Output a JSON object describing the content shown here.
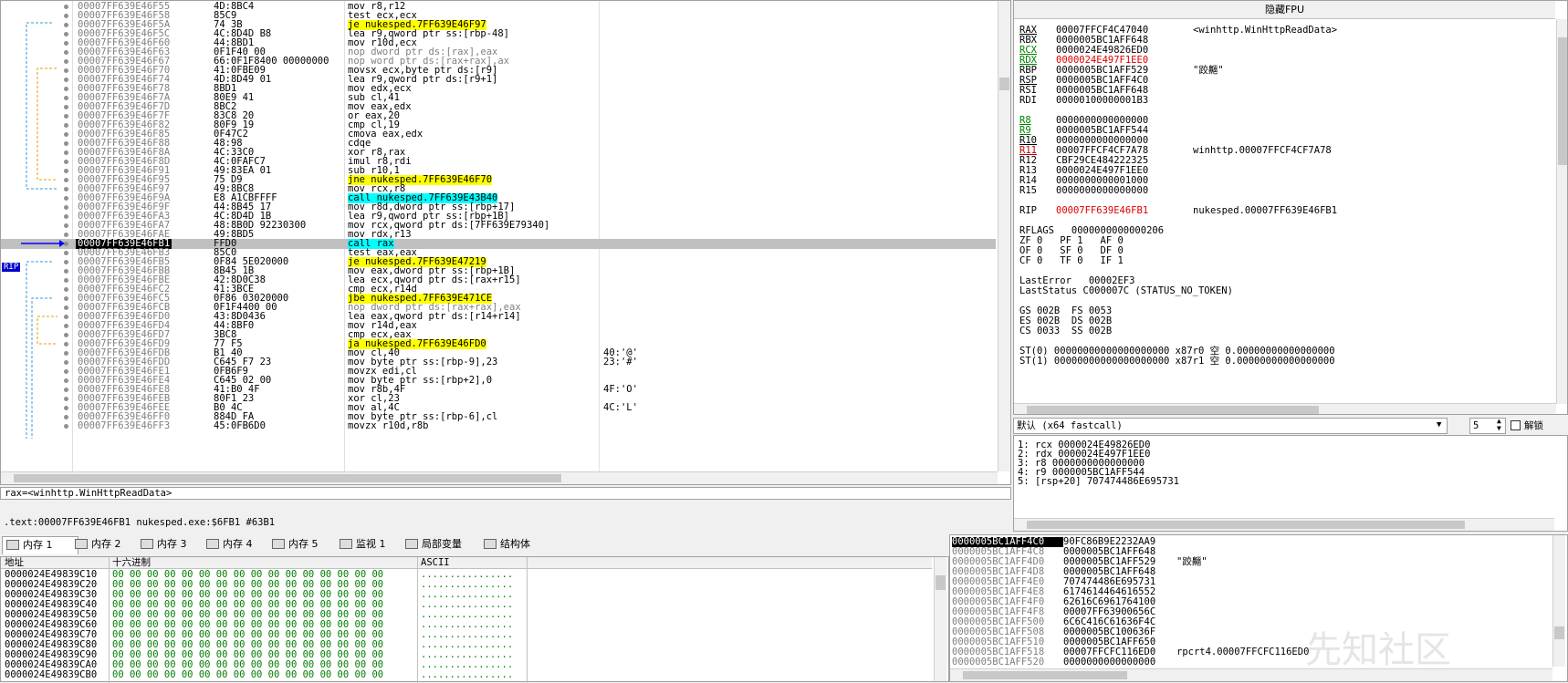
{
  "disasm": {
    "rows": [
      {
        "addr": "00007FF639E46F55",
        "bytes": "4D:8BC4",
        "instr": "mov r8,r12",
        "hl": ""
      },
      {
        "addr": "00007FF639E46F58",
        "bytes": "85C9",
        "instr": "test ecx,ecx",
        "hl": ""
      },
      {
        "addr": "00007FF639E46F5A",
        "bytes": "74 3B",
        "instr": "je nukesped.7FF639E46F97",
        "hl": "y"
      },
      {
        "addr": "00007FF639E46F5C",
        "bytes": "4C:8D4D B8",
        "instr": "lea r9,qword ptr ss:[rbp-48]",
        "hl": ""
      },
      {
        "addr": "00007FF639E46F60",
        "bytes": "44:8BD1",
        "instr": "mov r10d,ecx",
        "hl": ""
      },
      {
        "addr": "00007FF639E46F63",
        "bytes": "0F1F40 00",
        "instr": "nop dword ptr ds:[rax],eax",
        "hl": "g"
      },
      {
        "addr": "00007FF639E46F67",
        "bytes": "66:0F1F8400 00000000",
        "instr": "nop word ptr ds:[rax+rax],ax",
        "hl": "g"
      },
      {
        "addr": "00007FF639E46F70",
        "bytes": "41:0FBE09",
        "instr": "movsx ecx,byte ptr ds:[r9]",
        "hl": ""
      },
      {
        "addr": "00007FF639E46F74",
        "bytes": "4D:8D49 01",
        "instr": "lea r9,qword ptr ds:[r9+1]",
        "hl": ""
      },
      {
        "addr": "00007FF639E46F78",
        "bytes": "8BD1",
        "instr": "mov edx,ecx",
        "hl": ""
      },
      {
        "addr": "00007FF639E46F7A",
        "bytes": "80E9 41",
        "instr": "sub cl,41",
        "hl": ""
      },
      {
        "addr": "00007FF639E46F7D",
        "bytes": "8BC2",
        "instr": "mov eax,edx",
        "hl": ""
      },
      {
        "addr": "00007FF639E46F7F",
        "bytes": "83C8 20",
        "instr": "or eax,20",
        "hl": ""
      },
      {
        "addr": "00007FF639E46F82",
        "bytes": "80F9 19",
        "instr": "cmp cl,19",
        "hl": ""
      },
      {
        "addr": "00007FF639E46F85",
        "bytes": "0F47C2",
        "instr": "cmova eax,edx",
        "hl": ""
      },
      {
        "addr": "00007FF639E46F88",
        "bytes": "48:98",
        "instr": "cdqe",
        "hl": ""
      },
      {
        "addr": "00007FF639E46F8A",
        "bytes": "4C:33C0",
        "instr": "xor r8,rax",
        "hl": ""
      },
      {
        "addr": "00007FF639E46F8D",
        "bytes": "4C:0FAFC7",
        "instr": "imul r8,rdi",
        "hl": ""
      },
      {
        "addr": "00007FF639E46F91",
        "bytes": "49:83EA 01",
        "instr": "sub r10,1",
        "hl": ""
      },
      {
        "addr": "00007FF639E46F95",
        "bytes": "75 D9",
        "instr": "jne nukesped.7FF639E46F70",
        "hl": "y"
      },
      {
        "addr": "00007FF639E46F97",
        "bytes": "49:8BC8",
        "instr": "mov rcx,r8",
        "hl": ""
      },
      {
        "addr": "00007FF639E46F9A",
        "bytes": "E8 A1CBFFFF",
        "instr": "call nukesped.7FF639E43B40",
        "hl": "c"
      },
      {
        "addr": "00007FF639E46F9F",
        "bytes": "44:8B45 17",
        "instr": "mov r8d,dword ptr ss:[rbp+17]",
        "hl": ""
      },
      {
        "addr": "00007FF639E46FA3",
        "bytes": "4C:8D4D 1B",
        "instr": "lea r9,qword ptr ss:[rbp+1B]",
        "hl": ""
      },
      {
        "addr": "00007FF639E46FA7",
        "bytes": "48:8B0D 92230300",
        "instr": "mov rcx,qword ptr ds:[7FF639E79340]",
        "hl": ""
      },
      {
        "addr": "00007FF639E46FAE",
        "bytes": "49:8BD5",
        "instr": "mov rdx,r13",
        "hl": ""
      },
      {
        "addr": "00007FF639E46FB1",
        "bytes": "FFD0",
        "instr": "call rax",
        "hl": "c",
        "sel": true
      },
      {
        "addr": "00007FF639E46FB3",
        "bytes": "85C0",
        "instr": "test eax,eax",
        "hl": ""
      },
      {
        "addr": "00007FF639E46FB5",
        "bytes": "0F84 5E020000",
        "instr": "je nukesped.7FF639E47219",
        "hl": "y"
      },
      {
        "addr": "00007FF639E46FBB",
        "bytes": "8B45 1B",
        "instr": "mov eax,dword ptr ss:[rbp+1B]",
        "hl": ""
      },
      {
        "addr": "00007FF639E46FBE",
        "bytes": "42:8D0C38",
        "instr": "lea ecx,qword ptr ds:[rax+r15]",
        "hl": ""
      },
      {
        "addr": "00007FF639E46FC2",
        "bytes": "41:3BCE",
        "instr": "cmp ecx,r14d",
        "hl": ""
      },
      {
        "addr": "00007FF639E46FC5",
        "bytes": "0F86 03020000",
        "instr": "jbe nukesped.7FF639E471CE",
        "hl": "y"
      },
      {
        "addr": "00007FF639E46FCB",
        "bytes": "0F1F4400 00",
        "instr": "nop dword ptr ds:[rax+rax],eax",
        "hl": "g"
      },
      {
        "addr": "00007FF639E46FD0",
        "bytes": "43:8D0436",
        "instr": "lea eax,qword ptr ds:[r14+r14]",
        "hl": ""
      },
      {
        "addr": "00007FF639E46FD4",
        "bytes": "44:8BF0",
        "instr": "mov r14d,eax",
        "hl": ""
      },
      {
        "addr": "00007FF639E46FD7",
        "bytes": "3BC8",
        "instr": "cmp ecx,eax",
        "hl": ""
      },
      {
        "addr": "00007FF639E46FD9",
        "bytes": "77 F5",
        "instr": "ja nukesped.7FF639E46FD0",
        "hl": "y"
      },
      {
        "addr": "00007FF639E46FDB",
        "bytes": "B1 40",
        "instr": "mov cl,40",
        "hl": "",
        "cmt": "40:'@'"
      },
      {
        "addr": "00007FF639E46FDD",
        "bytes": "C645 F7 23",
        "instr": "mov byte ptr ss:[rbp-9],23",
        "hl": "",
        "cmt": "23:'#'"
      },
      {
        "addr": "00007FF639E46FE1",
        "bytes": "0FB6F9",
        "instr": "movzx edi,cl",
        "hl": ""
      },
      {
        "addr": "00007FF639E46FE4",
        "bytes": "C645 02 00",
        "instr": "mov byte ptr ss:[rbp+2],0",
        "hl": ""
      },
      {
        "addr": "00007FF639E46FE8",
        "bytes": "41:B0 4F",
        "instr": "mov r8b,4F",
        "hl": "",
        "cmt": "4F:'O'"
      },
      {
        "addr": "00007FF639E46FEB",
        "bytes": "80F1 23",
        "instr": "xor cl,23",
        "hl": ""
      },
      {
        "addr": "00007FF639E46FEE",
        "bytes": "B0 4C",
        "instr": "mov al,4C",
        "hl": "",
        "cmt": "4C:'L'"
      },
      {
        "addr": "00007FF639E46FF0",
        "bytes": "884D FA",
        "instr": "mov byte ptr ss:[rbp-6],cl",
        "hl": ""
      },
      {
        "addr": "00007FF639E46FF3",
        "bytes": "45:0FB6D0",
        "instr": "movzx r10d,r8b",
        "hl": ""
      }
    ],
    "rip_label": "RIP"
  },
  "status": {
    "line1": "rax=<winhttp.WinHttpReadData>",
    "line2": ".text:00007FF639E46FB1 nukesped.exe:$6FB1 #63B1"
  },
  "registers": {
    "header": "隐藏FPU",
    "rows": [
      {
        "name": "RAX",
        "val": "00007FFCF4C47040",
        "cmt": "<winhttp.WinHttpReadData>",
        "style": "u"
      },
      {
        "name": "RBX",
        "val": "0000005BC1AFF648",
        "cmt": ""
      },
      {
        "name": "RCX",
        "val": "0000024E49826ED0",
        "cmt": "",
        "style": "ug"
      },
      {
        "name": "RDX",
        "val": "0000024E497F1EE0",
        "cmt": "",
        "style": "ug",
        "red": true
      },
      {
        "name": "RBP",
        "val": "0000005BC1AFF529",
        "cmt": "\"跤齆\""
      },
      {
        "name": "RSP",
        "val": "0000005BC1AFF4C0",
        "cmt": "",
        "style": "u"
      },
      {
        "name": "RSI",
        "val": "0000005BC1AFF648",
        "cmt": ""
      },
      {
        "name": "RDI",
        "val": "00000100000001B3",
        "cmt": ""
      },
      {
        "name": "",
        "val": "",
        "cmt": ""
      },
      {
        "name": "R8",
        "val": "0000000000000000",
        "cmt": "",
        "style": "ug"
      },
      {
        "name": "R9",
        "val": "0000005BC1AFF544",
        "cmt": "",
        "style": "ug"
      },
      {
        "name": "R10",
        "val": "0000000000000000",
        "cmt": "",
        "style": "u"
      },
      {
        "name": "R11",
        "val": "00007FFCF4CF7A78",
        "cmt": "winhttp.00007FFCF4CF7A78",
        "style": "ur"
      },
      {
        "name": "R12",
        "val": "CBF29CE484222325",
        "cmt": ""
      },
      {
        "name": "R13",
        "val": "0000024E497F1EE0",
        "cmt": ""
      },
      {
        "name": "R14",
        "val": "0000000000001000",
        "cmt": ""
      },
      {
        "name": "R15",
        "val": "0000000000000000",
        "cmt": ""
      },
      {
        "name": "",
        "val": "",
        "cmt": ""
      },
      {
        "name": "RIP",
        "val": "00007FF639E46FB1",
        "cmt": "nukesped.00007FF639E46FB1",
        "red": true
      }
    ],
    "rflags_line": "RFLAGS   0000000000000206",
    "flags": [
      "ZF 0   PF 1   AF 0",
      "OF 0   SF 0   DF 0",
      "CF 0   TF 0   IF 1"
    ],
    "last_error": "LastError   00002EF3",
    "last_status": "LastStatus C000007C (STATUS_NO_TOKEN)",
    "segs": [
      "GS 002B  FS 0053",
      "ES 002B  DS 002B",
      "CS 0033  SS 002B"
    ],
    "st": [
      "ST(0) 00000000000000000000 x87r0 空 0.00000000000000000",
      "ST(1) 00000000000000000000 x87r1 空 0.00000000000000000"
    ]
  },
  "callconv": {
    "selected": "默认 (x64 fastcall)",
    "count": "5",
    "unlock_label": "解锁",
    "args": [
      "1: rcx 0000024E49826ED0",
      "2: rdx 0000024E497F1EE0",
      "3: r8 0000000000000000",
      "4: r9 0000005BC1AFF544",
      "5: [rsp+20] 707474486E695731"
    ]
  },
  "tabs": [
    {
      "label": "内存 1",
      "active": true,
      "icon": "memory-icon"
    },
    {
      "label": "内存 2",
      "icon": "memory-icon"
    },
    {
      "label": "内存 3",
      "icon": "memory-icon"
    },
    {
      "label": "内存 4",
      "icon": "memory-icon"
    },
    {
      "label": "内存 5",
      "icon": "memory-icon"
    },
    {
      "label": "监视 1",
      "icon": "watch-icon"
    },
    {
      "label": "局部变量",
      "icon": "locals-icon"
    },
    {
      "label": "结构体",
      "icon": "struct-icon"
    }
  ],
  "dump": {
    "headers": {
      "addr": "地址",
      "hex": "十六进制",
      "ascii": "ASCII"
    },
    "rows": [
      {
        "addr": "0000024E49839C10",
        "hex": "00 00 00 00 00 00 00 00 00 00 00 00 00 00 00 00",
        "ascii": "................"
      },
      {
        "addr": "0000024E49839C20",
        "hex": "00 00 00 00 00 00 00 00 00 00 00 00 00 00 00 00",
        "ascii": "................"
      },
      {
        "addr": "0000024E49839C30",
        "hex": "00 00 00 00 00 00 00 00 00 00 00 00 00 00 00 00",
        "ascii": "................"
      },
      {
        "addr": "0000024E49839C40",
        "hex": "00 00 00 00 00 00 00 00 00 00 00 00 00 00 00 00",
        "ascii": "................"
      },
      {
        "addr": "0000024E49839C50",
        "hex": "00 00 00 00 00 00 00 00 00 00 00 00 00 00 00 00",
        "ascii": "................"
      },
      {
        "addr": "0000024E49839C60",
        "hex": "00 00 00 00 00 00 00 00 00 00 00 00 00 00 00 00",
        "ascii": "................"
      },
      {
        "addr": "0000024E49839C70",
        "hex": "00 00 00 00 00 00 00 00 00 00 00 00 00 00 00 00",
        "ascii": "................"
      },
      {
        "addr": "0000024E49839C80",
        "hex": "00 00 00 00 00 00 00 00 00 00 00 00 00 00 00 00",
        "ascii": "................"
      },
      {
        "addr": "0000024E49839C90",
        "hex": "00 00 00 00 00 00 00 00 00 00 00 00 00 00 00 00",
        "ascii": "................"
      },
      {
        "addr": "0000024E49839CA0",
        "hex": "00 00 00 00 00 00 00 00 00 00 00 00 00 00 00 00",
        "ascii": "................"
      },
      {
        "addr": "0000024E49839CB0",
        "hex": "00 00 00 00 00 00 00 00 00 00 00 00 00 00 00 00",
        "ascii": "................"
      }
    ]
  },
  "stack": {
    "rows": [
      {
        "addr": "0000005BC1AFF4C0",
        "val": "90FC86B9E2232AA9",
        "cmt": "",
        "sel": true
      },
      {
        "addr": "0000005BC1AFF4C8",
        "val": "0000005BC1AFF648",
        "cmt": ""
      },
      {
        "addr": "0000005BC1AFF4D0",
        "val": "0000005BC1AFF529",
        "cmt": "\"跤齆\""
      },
      {
        "addr": "0000005BC1AFF4D8",
        "val": "0000005BC1AFF648",
        "cmt": ""
      },
      {
        "addr": "0000005BC1AFF4E0",
        "val": "707474486E695731",
        "cmt": ""
      },
      {
        "addr": "0000005BC1AFF4E8",
        "val": "6174614464616552",
        "cmt": ""
      },
      {
        "addr": "0000005BC1AFF4F0",
        "val": "62616C6961764100",
        "cmt": ""
      },
      {
        "addr": "0000005BC1AFF4F8",
        "val": "00007FF63900656C",
        "cmt": ""
      },
      {
        "addr": "0000005BC1AFF500",
        "val": "6C6C416C61636F4C",
        "cmt": ""
      },
      {
        "addr": "0000005BC1AFF508",
        "val": "0000005BC100636F",
        "cmt": ""
      },
      {
        "addr": "0000005BC1AFF510",
        "val": "0000005BC1AFF650",
        "cmt": ""
      },
      {
        "addr": "0000005BC1AFF518",
        "val": "00007FFCFC116ED0",
        "cmt": "rpcrt4.00007FFCFC116ED0"
      },
      {
        "addr": "0000005BC1AFF520",
        "val": "0000000000000000",
        "cmt": ""
      }
    ]
  },
  "watermark": "先知社区"
}
